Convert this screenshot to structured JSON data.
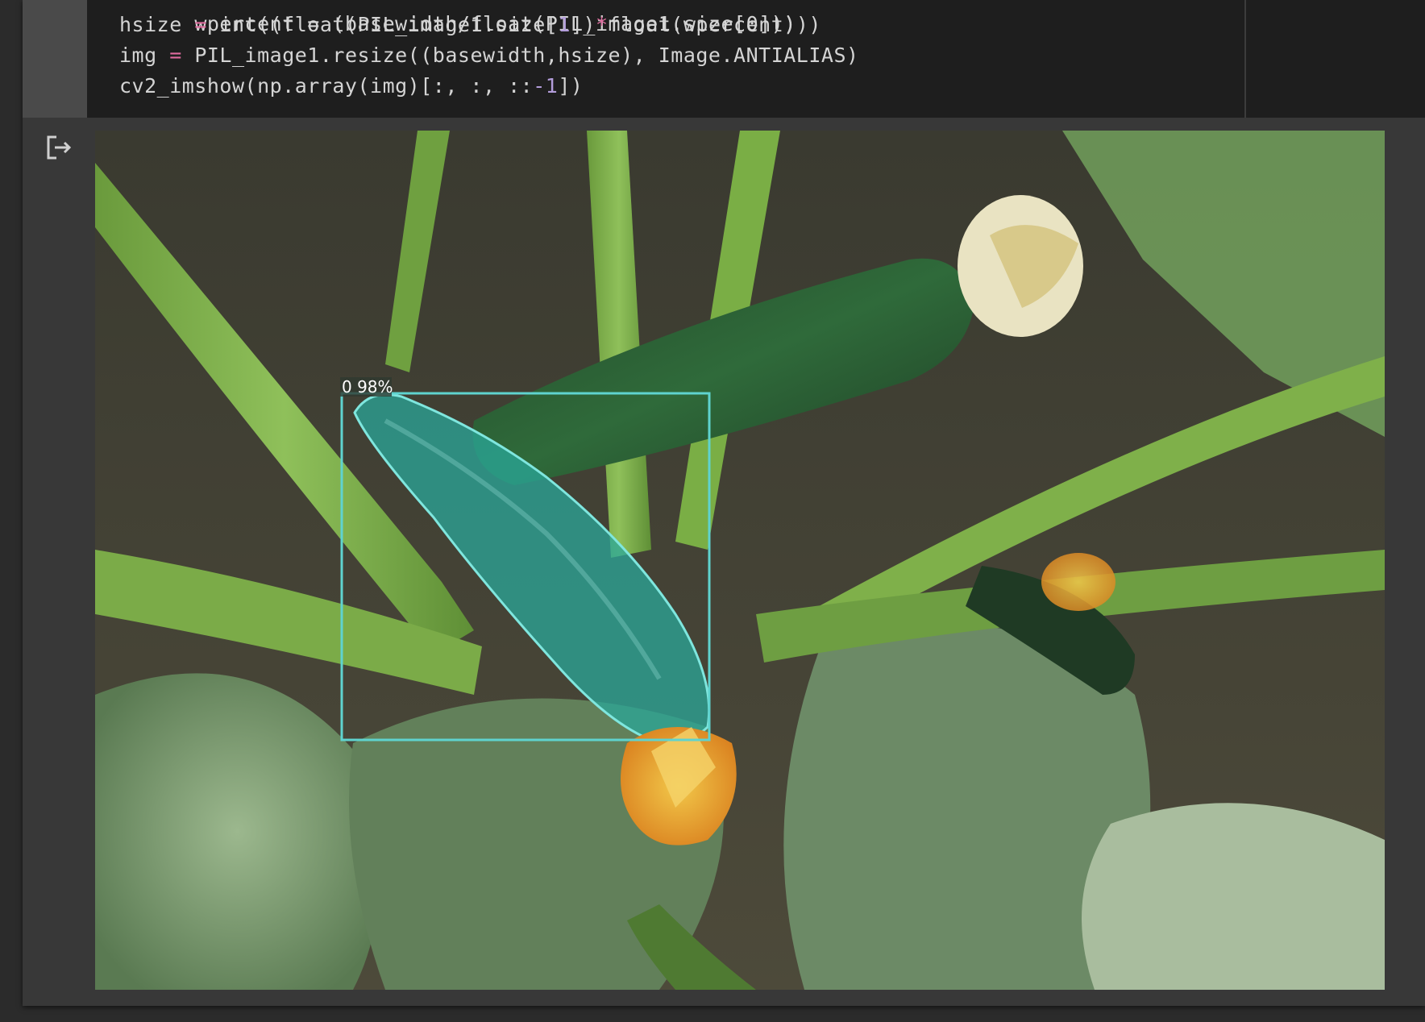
{
  "code": {
    "line0": "wpercent = (basewidth/float(PIL_image1.size[0]))",
    "line1": {
      "a": "hsize ",
      "eq": "=",
      "b": " int((float(PIL_image1.size[",
      "n": "1",
      "c": "])",
      "mul": "*",
      "d": "float(wpercent)))"
    },
    "line2": {
      "a": "img ",
      "eq": "=",
      "b": " PIL_image1.resize((basewidth,hsize), Image.ANTIALIAS)"
    },
    "line3": {
      "a": "cv2_imshow(np.array(img)[:, :, ::",
      "neg": "-1",
      "b": "])"
    }
  },
  "output": {
    "icon": "output-redirect-icon",
    "detection_label": "0 98%",
    "colors": {
      "bbox": "#5fd3cf",
      "mask": "#2aa79a",
      "label_bg": "#2f3a2f"
    }
  }
}
